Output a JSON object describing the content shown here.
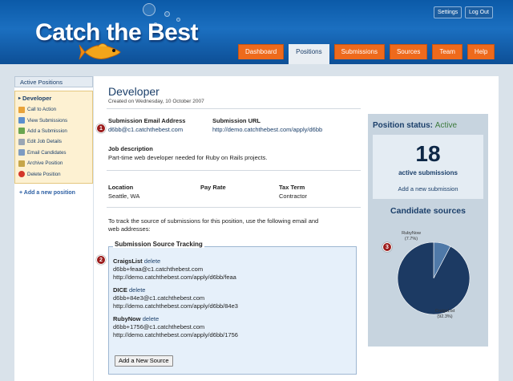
{
  "header": {
    "logo": "Catch the Best",
    "settings": "Settings",
    "logout": "Log Out",
    "tabs": [
      {
        "label": "Dashboard",
        "active": false
      },
      {
        "label": "Positions",
        "active": true
      },
      {
        "label": "Submissions",
        "active": false
      },
      {
        "label": "Sources",
        "active": false
      },
      {
        "label": "Team",
        "active": false
      },
      {
        "label": "Help",
        "active": false
      }
    ]
  },
  "sidebar": {
    "heading": "Active Positions",
    "position": "Developer",
    "items": [
      {
        "label": "Call to Action",
        "icon": "megaphone-icon",
        "color": "#e8a33a"
      },
      {
        "label": "View Submissions",
        "icon": "list-icon",
        "color": "#5b8fcf"
      },
      {
        "label": "Add a Submission",
        "icon": "add-icon",
        "color": "#6aa64f"
      },
      {
        "label": "Edit Job Details",
        "icon": "edit-icon",
        "color": "#9aa6b4"
      },
      {
        "label": "Email Candidates",
        "icon": "email-icon",
        "color": "#7d9bc2"
      },
      {
        "label": "Archive Position",
        "icon": "archive-icon",
        "color": "#c6a64a"
      },
      {
        "label": "Delete Position",
        "icon": "delete-icon",
        "color": "#d4362a"
      }
    ],
    "add_position": "Add a new position"
  },
  "main": {
    "title": "Developer",
    "created": "Created on Wednesday, 10 October 2007",
    "email_label": "Submission Email Address",
    "email_value": "d6bb@c1.catchthebest.com",
    "url_label": "Submission URL",
    "url_value": "http://demo.catchthebest.com/apply/d6bb",
    "desc_label": "Job description",
    "desc_value": "Part-time web developer needed for Ruby on Rails projects.",
    "location_label": "Location",
    "location_value": "Seattle, WA",
    "pay_label": "Pay Rate",
    "tax_label": "Tax Term",
    "tax_value": "Contractor",
    "track_text_1": "To track the source of submissions for this position, use the following email and",
    "track_text_2": "web addresses:",
    "tracking_title": "Submission Source Tracking",
    "delete_label": "delete",
    "sources": [
      {
        "name": "CraigsList",
        "email": "d6bb+feaa@c1.catchthebest.com",
        "url": "http://demo.catchthebest.com/apply/d6bb/feaa"
      },
      {
        "name": "DICE",
        "email": "d6bb+84e3@c1.catchthebest.com",
        "url": "http://demo.catchthebest.com/apply/d6bb/84e3"
      },
      {
        "name": "RubyNow",
        "email": "d6bb+1756@c1.catchthebest.com",
        "url": "http://demo.catchthebest.com/apply/d6bb/1756"
      }
    ],
    "add_source": "Add a New Source",
    "markers": [
      "1",
      "2",
      "3"
    ]
  },
  "status_panel": {
    "status_label": "Position status:",
    "status_value": "Active",
    "count": "18",
    "count_label": "active submissions",
    "add_submission": "Add a new submission",
    "sources_title": "Candidate sources"
  },
  "chart_data": {
    "type": "pie",
    "title": "Candidate sources",
    "slices": [
      {
        "label": "RubyNow",
        "pct_label": "(7.7%)",
        "value": 7.7,
        "color": "#4f79a8"
      },
      {
        "label": "CraigsList",
        "pct_label": "(92.3%)",
        "value": 92.3,
        "color": "#1c3a63"
      }
    ]
  }
}
